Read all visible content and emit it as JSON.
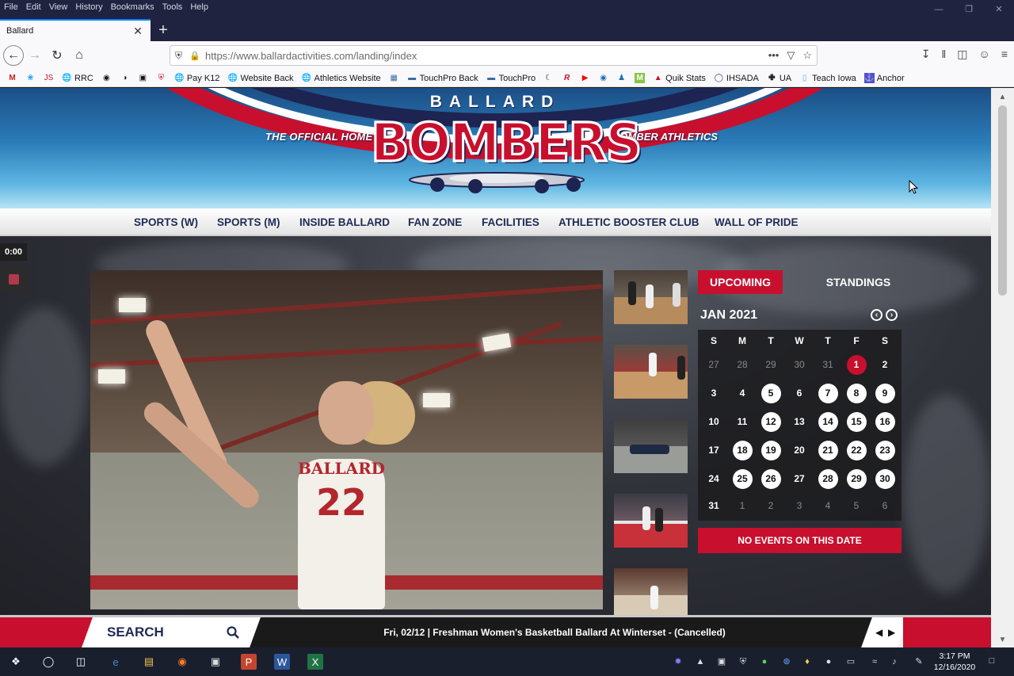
{
  "browser": {
    "menu": [
      "File",
      "Edit",
      "View",
      "History",
      "Bookmarks",
      "Tools",
      "Help"
    ],
    "tab_title": "Ballard",
    "url": "https://www.ballardactivities.com/landing/index",
    "bookmarks": [
      "RRC",
      "Pay K12",
      "Website Back",
      "Athletics Website",
      "TouchPro Back",
      "TouchPro",
      "Quik Stats",
      "IHSADA",
      "UA",
      "Teach Iowa",
      "Anchor"
    ]
  },
  "header": {
    "logo_top": "BALLARD",
    "logo_main": "BOMBERS",
    "tagline_left": "THE OFFICIAL HOME OF",
    "tagline_right": "BOMBER ATHLETICS"
  },
  "nav": [
    "SPORTS (W)",
    "SPORTS (M)",
    "INSIDE BALLARD",
    "FAN ZONE",
    "FACILITIES",
    "ATHLETIC BOOSTER CLUB",
    "WALL OF PRIDE"
  ],
  "media": {
    "timer": "0:00"
  },
  "hero": {
    "jersey_name": "BALLARD",
    "jersey_number": "22"
  },
  "calendar": {
    "tab_upcoming": "UPCOMING",
    "tab_standings": "STANDINGS",
    "month": "JAN 2021",
    "weekdays": [
      "S",
      "M",
      "T",
      "W",
      "T",
      "F",
      "S"
    ],
    "weeks": [
      [
        "27",
        "28",
        "29",
        "30",
        "31",
        "1",
        "2"
      ],
      [
        "3",
        "4",
        "5",
        "6",
        "7",
        "8",
        "9"
      ],
      [
        "10",
        "11",
        "12",
        "13",
        "14",
        "15",
        "16"
      ],
      [
        "17",
        "18",
        "19",
        "20",
        "21",
        "22",
        "23"
      ],
      [
        "24",
        "25",
        "26",
        "27",
        "28",
        "29",
        "30"
      ],
      [
        "31",
        "1",
        "2",
        "3",
        "4",
        "5",
        "6"
      ]
    ],
    "no_events": "NO EVENTS ON THIS DATE"
  },
  "ticker": {
    "search_label": "SEARCH",
    "news": "Fri, 02/12 | Freshman Women's Basketball Ballard At Winterset - (Cancelled)"
  },
  "taskbar": {
    "time": "3:17 PM",
    "date": "12/16/2020"
  },
  "colors": {
    "brand_red": "#c8102e",
    "brand_navy": "#1f2a55"
  }
}
